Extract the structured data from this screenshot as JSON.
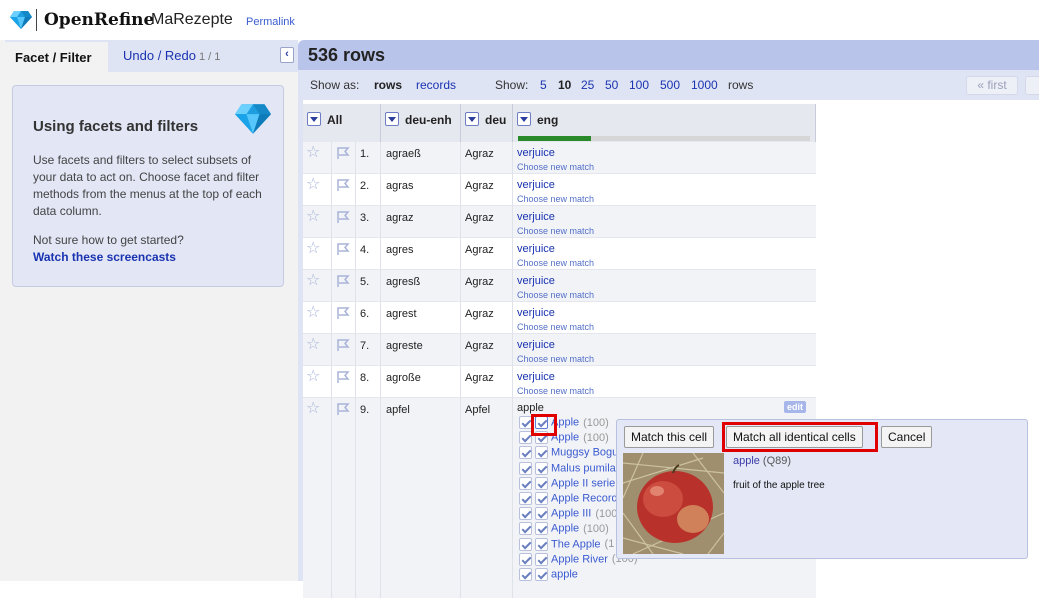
{
  "header": {
    "app_name": "OpenRefine",
    "project_name": "MaRezepte",
    "permalink": "Permalink"
  },
  "left_panel": {
    "tabs": [
      {
        "label": "Facet / Filter",
        "selected": true
      },
      {
        "label": "Undo / Redo",
        "count": "1 / 1",
        "selected": false
      }
    ],
    "collapse_icon": "chevron-left-icon",
    "help": {
      "title": "Using facets and filters",
      "text": "Use facets and filters to select subsets of your data to act on. Choose facet and filter methods from the menus at the top of each data column.",
      "question": "Not sure how to get started?",
      "link": "Watch these screencasts"
    }
  },
  "view": {
    "rows_count": "536 rows",
    "show_as_label": "Show as:",
    "show_as_rows": "rows",
    "show_as_records": "records",
    "show_label": "Show:",
    "page_sizes": [
      "5",
      "10",
      "25",
      "50",
      "100",
      "500",
      "1000"
    ],
    "page_size_selected": "10",
    "rows_word": "rows",
    "first_label": "« first"
  },
  "table": {
    "columns": [
      "All",
      "deu-enh",
      "deu",
      "eng"
    ],
    "eng_reconciled_fraction": 0.25,
    "choose_label": "Choose new match",
    "rows": [
      {
        "num": "1.",
        "deu_enh": "agraeß",
        "deu": "Agraz",
        "eng": "verjuice"
      },
      {
        "num": "2.",
        "deu_enh": "agras",
        "deu": "Agraz",
        "eng": "verjuice"
      },
      {
        "num": "3.",
        "deu_enh": "agraz",
        "deu": "Agraz",
        "eng": "verjuice"
      },
      {
        "num": "4.",
        "deu_enh": "agres",
        "deu": "Agraz",
        "eng": "verjuice"
      },
      {
        "num": "5.",
        "deu_enh": "agresß",
        "deu": "Agraz",
        "eng": "verjuice"
      },
      {
        "num": "6.",
        "deu_enh": "agrest",
        "deu": "Agraz",
        "eng": "verjuice"
      },
      {
        "num": "7.",
        "deu_enh": "agreste",
        "deu": "Agraz",
        "eng": "verjuice"
      },
      {
        "num": "8.",
        "deu_enh": "agroße",
        "deu": "Agraz",
        "eng": "verjuice"
      }
    ],
    "row9": {
      "num": "9.",
      "deu_enh": "apfel",
      "deu": "Apfel",
      "eng": "apple",
      "edit_label": "edit",
      "candidates": [
        {
          "name": "Apple",
          "score": "(100)"
        },
        {
          "name": "Apple",
          "score": "(100)"
        },
        {
          "name": "Muggsy Bogu",
          "score": ""
        },
        {
          "name": "Malus pumila",
          "score": ""
        },
        {
          "name": "Apple II serie",
          "score": ""
        },
        {
          "name": "Apple Record",
          "score": ""
        },
        {
          "name": "Apple III",
          "score": "(100)"
        },
        {
          "name": "Apple",
          "score": "(100)"
        },
        {
          "name": "The Apple",
          "score": "(1"
        },
        {
          "name": "Apple River",
          "score": "(100)"
        },
        {
          "name": "apple",
          "score": ""
        }
      ]
    }
  },
  "popup": {
    "match_cell": "Match this cell",
    "match_all": "Match all identical cells",
    "cancel": "Cancel",
    "entity_name": "apple",
    "entity_id": "(Q89)",
    "entity_desc": "fruit of the apple tree"
  }
}
